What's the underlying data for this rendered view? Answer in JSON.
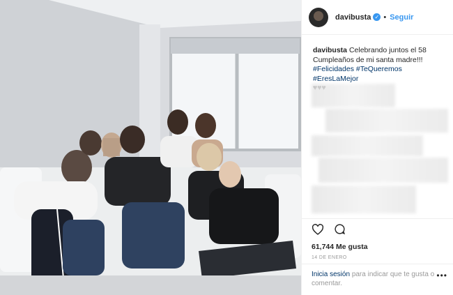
{
  "header": {
    "username": "davibusta",
    "separator": "•",
    "follow_label": "Seguir"
  },
  "caption": {
    "username": "davibusta",
    "text": "Celebrando juntos el 58 Cumpleaños de mi santa madre!!!",
    "hashtags": "#Felicidades #TeQueremos #EresLaMejor",
    "hearts": "♥♥♥"
  },
  "engagement": {
    "likes": "61,744 Me gusta",
    "date": "14 DE ENERO"
  },
  "login": {
    "link": "Inicia sesión",
    "text": "para indicar que te gusta o comentar."
  },
  "more_label": "•••",
  "icons": {
    "verified": "verified-check-icon",
    "like": "heart-icon",
    "comment": "comment-bubble-icon",
    "more": "more-options-icon"
  },
  "colors": {
    "link_blue": "#3897f0",
    "hashtag": "#003569",
    "muted": "#999999"
  }
}
